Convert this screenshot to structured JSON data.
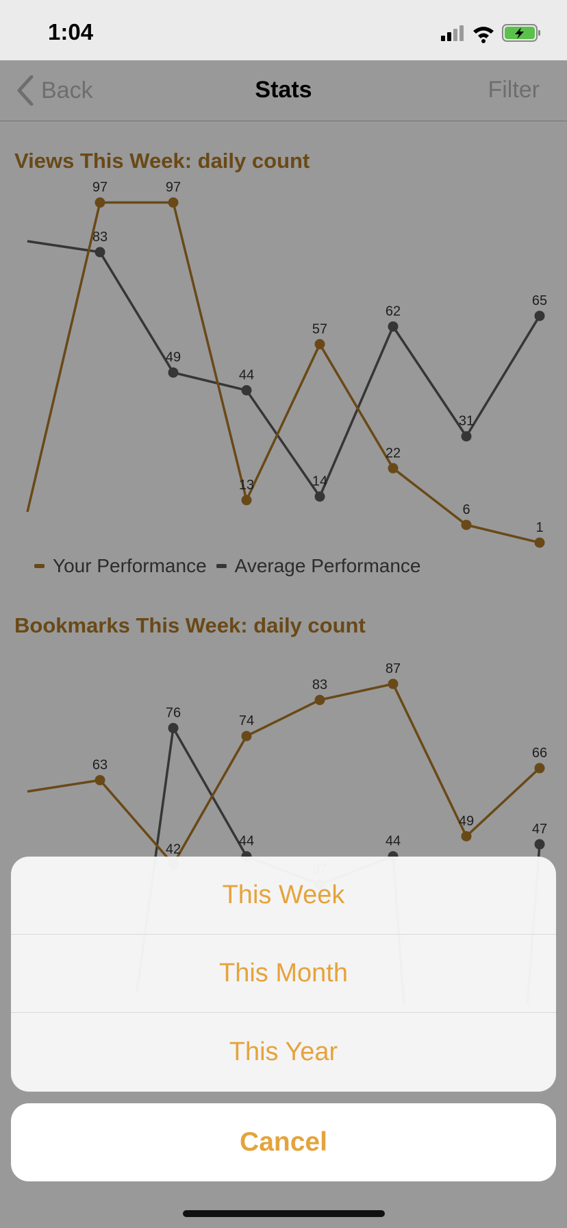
{
  "status": {
    "time": "1:04"
  },
  "nav": {
    "back": "Back",
    "title": "Stats",
    "filter": "Filter"
  },
  "colors": {
    "your": "#b07a27",
    "average": "#5a5a5a",
    "accent": "#e5a33c"
  },
  "legend": {
    "your": "Your Performance",
    "average": "Average Performance"
  },
  "charts": [
    {
      "title": "Views This Week: daily count",
      "chart_data": {
        "type": "line",
        "title": "Views This Week: daily count",
        "series": [
          {
            "name": "Your Performance",
            "values": [
              97,
              97,
              13,
              57,
              22,
              6,
              1
            ],
            "labels": [
              "97",
              "97",
              "13",
              "57",
              "22",
              "6",
              "1"
            ]
          },
          {
            "name": "Average Performance",
            "values": [
              83,
              49,
              44,
              14,
              62,
              31,
              65
            ],
            "labels": [
              "83",
              "49",
              "44",
              "14",
              "62",
              "31",
              "65"
            ]
          }
        ]
      }
    },
    {
      "title": "Bookmarks This Week: daily count",
      "chart_data": {
        "type": "line",
        "title": "Bookmarks This Week: daily count",
        "series": [
          {
            "name": "Your Performance",
            "values": [
              63,
              42,
              74,
              83,
              87,
              49,
              66
            ],
            "labels": [
              "63",
              "42",
              "74",
              "83",
              "87",
              "49",
              "66"
            ]
          },
          {
            "name": "Average Performance",
            "values": [
              76,
              44,
              37,
              44,
              47
            ],
            "labels": [
              "76",
              "44",
              "37",
              "44",
              "47"
            ]
          }
        ]
      }
    }
  ],
  "action_sheet": {
    "options": [
      "This Week",
      "This Month",
      "This Year"
    ],
    "cancel": "Cancel"
  }
}
